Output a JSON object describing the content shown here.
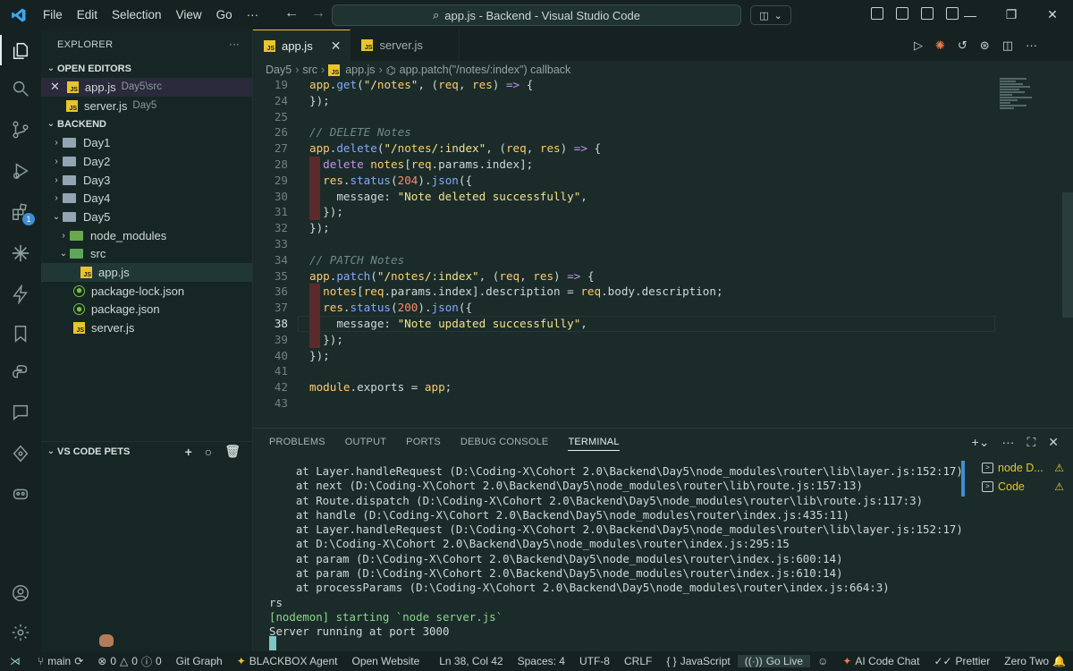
{
  "window": {
    "menu": [
      "File",
      "Edit",
      "Selection",
      "View",
      "Go",
      "···"
    ],
    "command_center": "app.js - Backend - Visual Studio Code",
    "controls": [
      "—",
      "❐",
      "✕"
    ]
  },
  "sidebar": {
    "title": "EXPLORER",
    "more": "···",
    "open_editors": {
      "header": "OPEN EDITORS",
      "items": [
        {
          "name": "app.js",
          "path": "Day5\\src"
        },
        {
          "name": "server.js",
          "path": "Day5"
        }
      ]
    },
    "backend": {
      "header": "BACKEND",
      "items": [
        "Day1",
        "Day2",
        "Day3",
        "Day4",
        "Day5",
        "node_modules",
        "src",
        "app.js",
        "package-lock.json",
        "package.json",
        "server.js"
      ]
    },
    "pets_header": "VS CODE PETS"
  },
  "tabs": [
    {
      "label": "app.js",
      "active": true
    },
    {
      "label": "server.js",
      "active": false
    }
  ],
  "breadcrumb": [
    "Day5",
    "src",
    "app.js",
    "app.patch(\"/notes/:index\") callback"
  ],
  "code_lines": [
    19,
    24,
    25,
    26,
    27,
    28,
    29,
    30,
    31,
    32,
    33,
    34,
    35,
    36,
    37,
    38,
    39,
    40,
    41,
    42,
    43
  ],
  "code_text": [
    "app.get(\"/notes\", (req, res) => {",
    "});",
    "",
    "// DELETE Notes",
    "app.delete(\"/notes/:index\", (req, res) => {",
    "  delete notes[req.params.index];",
    "  res.status(204).json({",
    "    message: \"Note deleted successfully\",",
    "  });",
    "});",
    "",
    "// PATCH Notes",
    "app.patch(\"/notes/:index\", (req, res) => {",
    "  notes[req.params.index].description = req.body.description;",
    "  res.status(200).json({",
    "    message: \"Note updated successfully\",",
    "  });",
    "});",
    "",
    "module.exports = app;",
    ""
  ],
  "panel": {
    "tabs": [
      "PROBLEMS",
      "OUTPUT",
      "PORTS",
      "DEBUG CONSOLE",
      "TERMINAL"
    ],
    "terminal_lines": [
      "    at Layer.handleRequest (D:\\Coding-X\\Cohort 2.0\\Backend\\Day5\\node_modules\\router\\lib\\layer.js:152:17)",
      "    at next (D:\\Coding-X\\Cohort 2.0\\Backend\\Day5\\node_modules\\router\\lib\\route.js:157:13)",
      "    at Route.dispatch (D:\\Coding-X\\Cohort 2.0\\Backend\\Day5\\node_modules\\router\\lib\\route.js:117:3)",
      "    at handle (D:\\Coding-X\\Cohort 2.0\\Backend\\Day5\\node_modules\\router\\index.js:435:11)",
      "    at Layer.handleRequest (D:\\Coding-X\\Cohort 2.0\\Backend\\Day5\\node_modules\\router\\lib\\layer.js:152:17)",
      "    at D:\\Coding-X\\Cohort 2.0\\Backend\\Day5\\node_modules\\router\\index.js:295:15",
      "    at param (D:\\Coding-X\\Cohort 2.0\\Backend\\Day5\\node_modules\\router\\index.js:600:14)",
      "    at param (D:\\Coding-X\\Cohort 2.0\\Backend\\Day5\\node_modules\\router\\index.js:610:14)",
      "    at processParams (D:\\Coding-X\\Cohort 2.0\\Backend\\Day5\\node_modules\\router\\index.js:664:3)",
      "rs",
      "[nodemon] starting `node server.js`",
      "Server running at port 3000"
    ],
    "terminals": [
      {
        "label": "node D...",
        "warn": "⚠"
      },
      {
        "label": "Code",
        "warn": "⚠"
      }
    ]
  },
  "statusbar": {
    "branch": "main",
    "errors": "0",
    "warnings": "0",
    "info": "0",
    "git_graph": "Git Graph",
    "blackbox": "BLACKBOX Agent",
    "open_website": "Open Website",
    "position": "Ln 38, Col 42",
    "spaces": "Spaces: 4",
    "encoding": "UTF-8",
    "eol": "CRLF",
    "language": "JavaScript",
    "go_live": "Go Live",
    "ai_chat": "AI Code Chat",
    "prettier": "Prettier",
    "theme": "Zero Two"
  },
  "colors": {
    "accent": "#e8c52b",
    "background": "#1b2b2a",
    "activity_badge": "#3d8fd1"
  }
}
